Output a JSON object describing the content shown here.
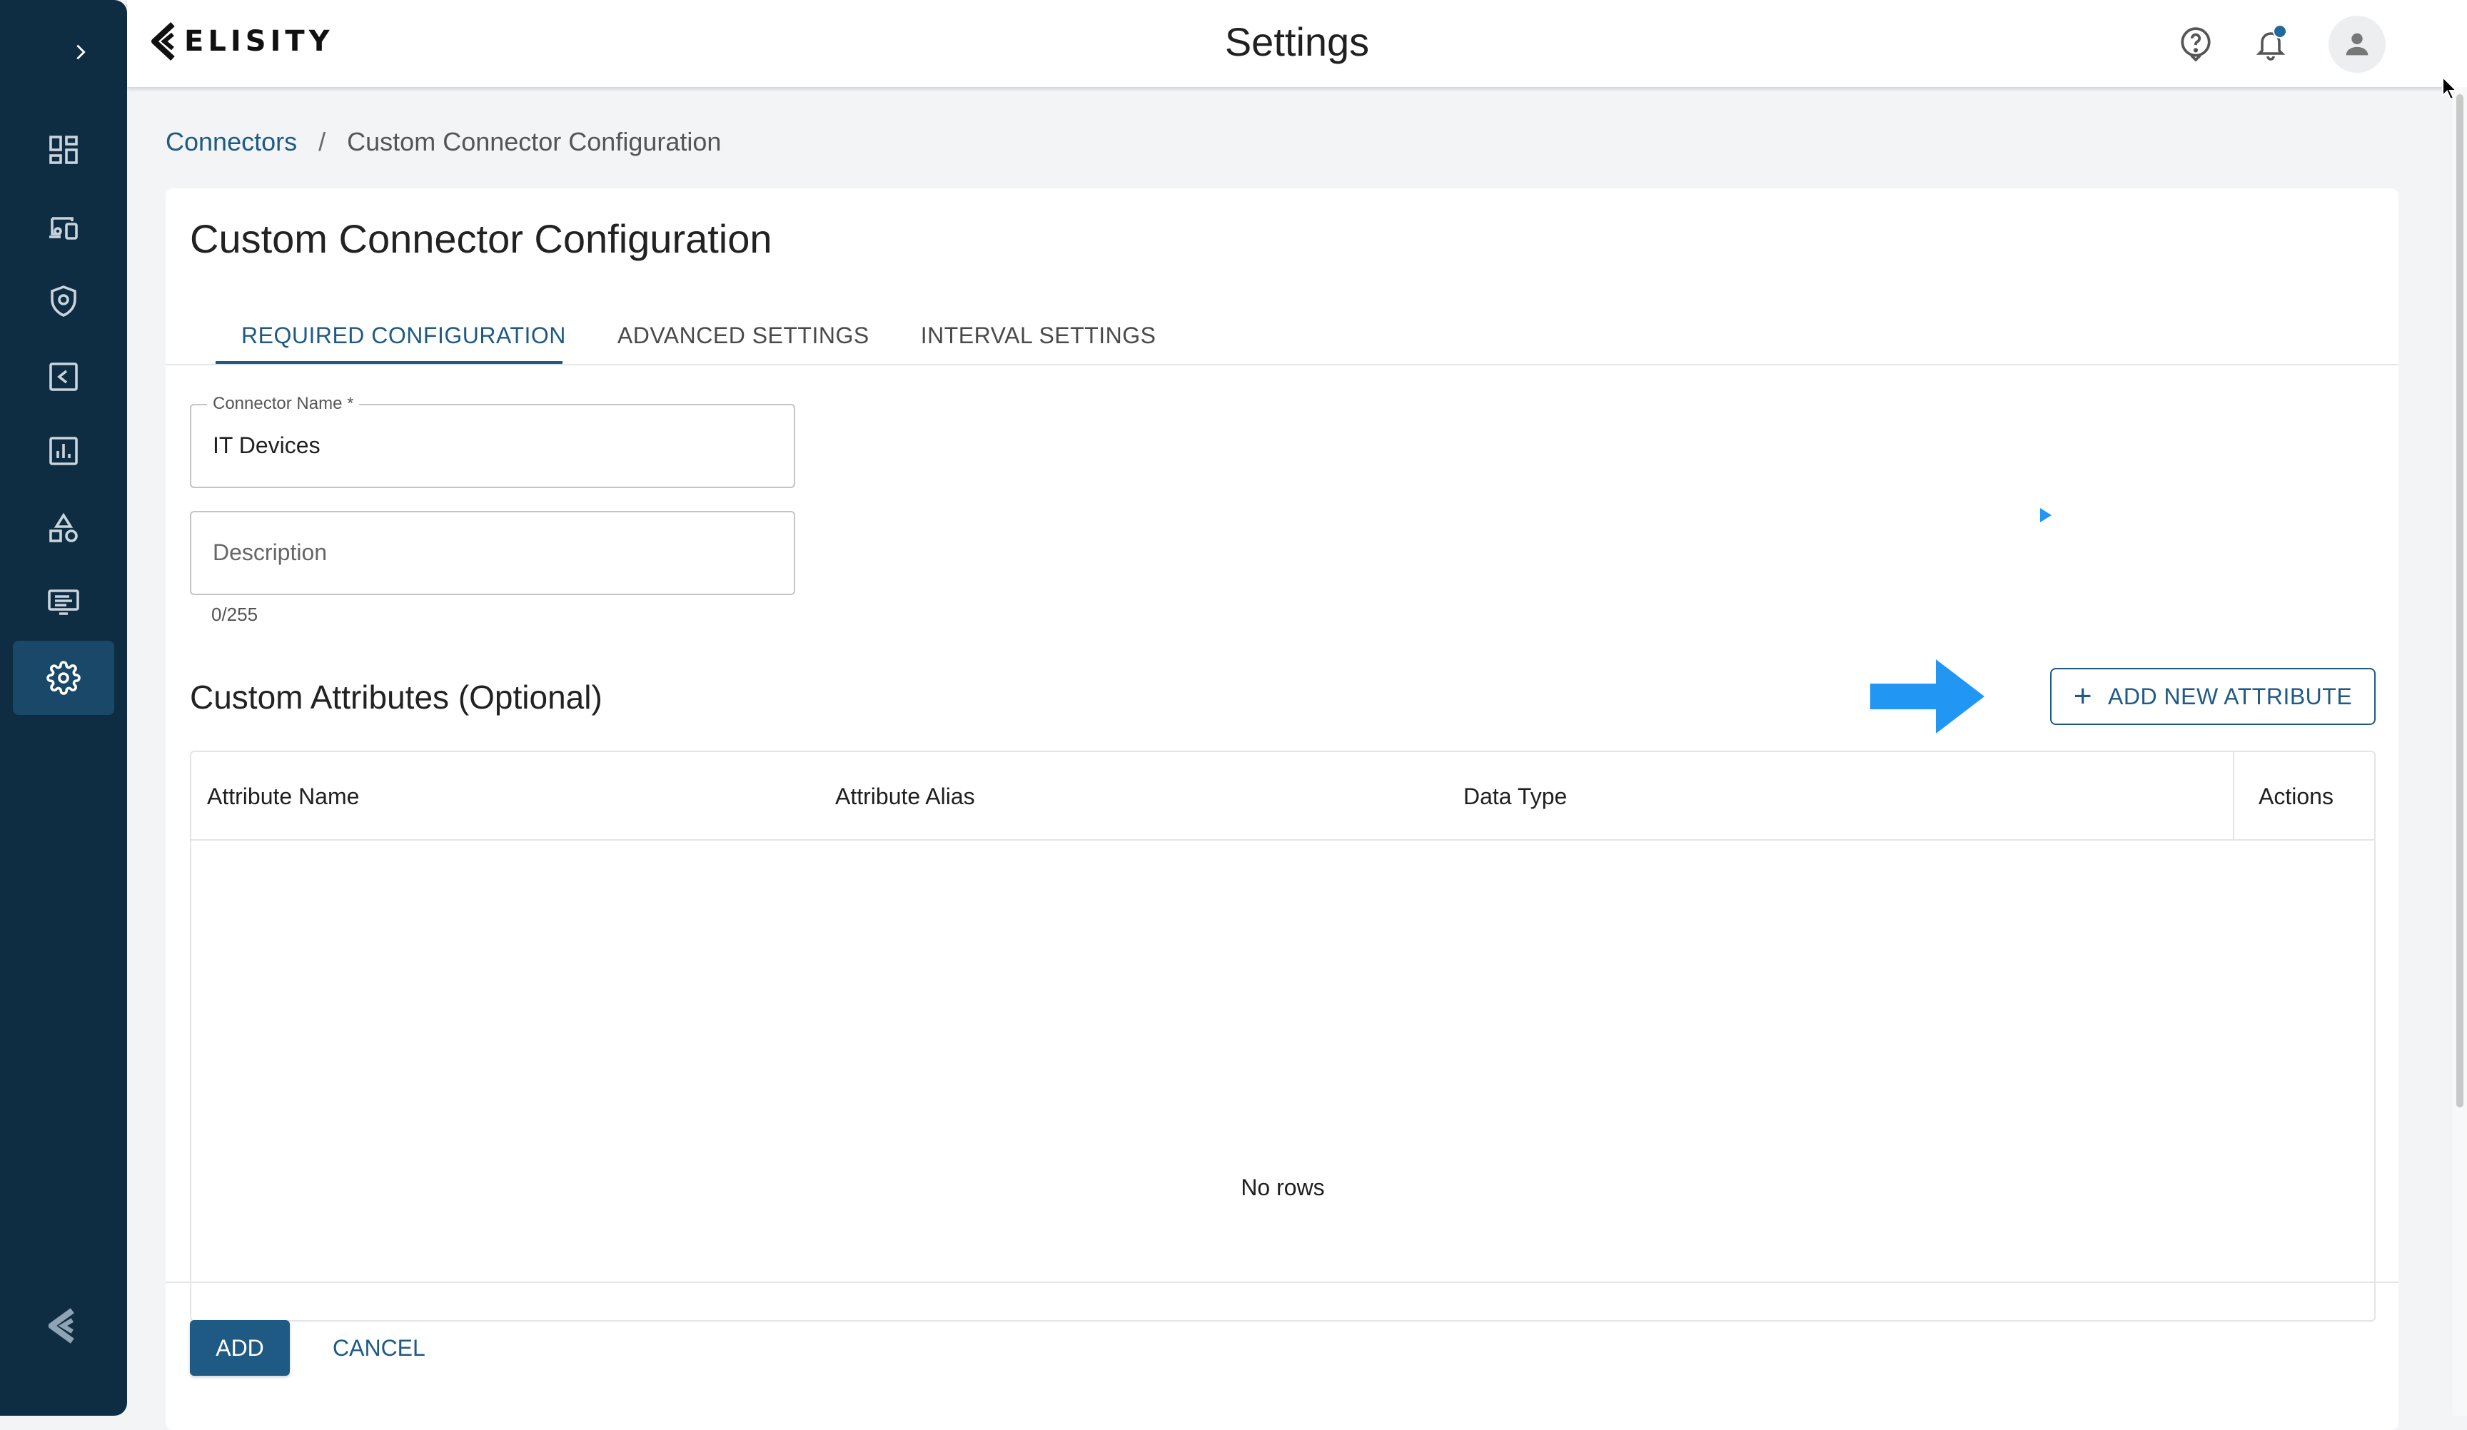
{
  "app": {
    "brand": "ELISITY",
    "page_title": "Settings"
  },
  "sidebar": {
    "items": [
      {
        "icon": "dashboard-icon"
      },
      {
        "icon": "devices-icon"
      },
      {
        "icon": "policy-shield-icon"
      },
      {
        "icon": "collector-icon"
      },
      {
        "icon": "analytics-icon"
      },
      {
        "icon": "shapes-icon"
      },
      {
        "icon": "monitor-icon"
      },
      {
        "icon": "settings-gear-icon",
        "active": true
      }
    ]
  },
  "breadcrumb": {
    "root": "Connectors",
    "separator": "/",
    "current": "Custom Connector Configuration"
  },
  "card": {
    "title": "Custom Connector Configuration",
    "tabs": [
      {
        "label": "REQUIRED CONFIGURATION",
        "active": true
      },
      {
        "label": "ADVANCED SETTINGS"
      },
      {
        "label": "INTERVAL SETTINGS"
      }
    ]
  },
  "form": {
    "connector_name": {
      "label": "Connector Name *",
      "value": "IT Devices"
    },
    "description": {
      "placeholder": "Description",
      "counter": "0/255"
    }
  },
  "attributes": {
    "title": "Custom Attributes (Optional)",
    "add_button": "ADD NEW ATTRIBUTE",
    "columns": [
      "Attribute Name",
      "Attribute Alias",
      "Data Type",
      "Actions"
    ],
    "empty_text": "No rows"
  },
  "footer": {
    "add_label": "ADD",
    "cancel_label": "CANCEL"
  },
  "colors": {
    "sidebar": "#0f2d42",
    "accent": "#1f5a85",
    "annotation_arrow": "#2196f3"
  }
}
